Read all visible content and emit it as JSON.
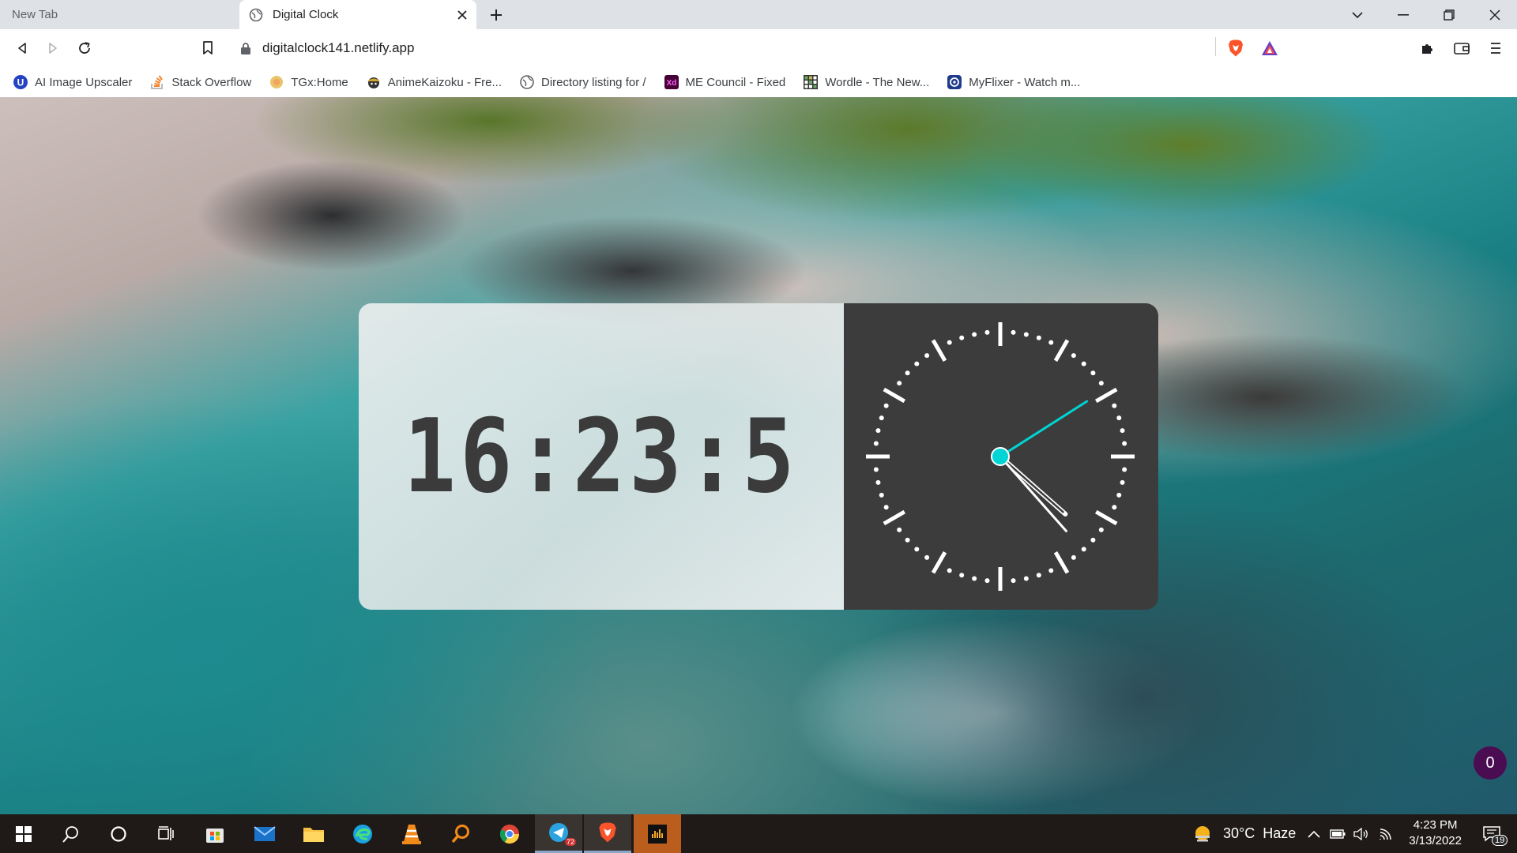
{
  "browser": {
    "tabs": [
      {
        "title": "New Tab",
        "active": false
      },
      {
        "title": "Digital Clock",
        "active": true
      }
    ],
    "url": "digitalclock141.netlify.app",
    "bookmarks": [
      {
        "label": "AI Image Upscaler",
        "icon": "u-circle-icon"
      },
      {
        "label": "Stack Overflow",
        "icon": "stackoverflow-icon"
      },
      {
        "label": "TGx:Home",
        "icon": "tgx-icon"
      },
      {
        "label": "AnimeKaizoku - Fre...",
        "icon": "animekaizoku-icon"
      },
      {
        "label": "Directory listing for /",
        "icon": "globe-icon"
      },
      {
        "label": "ME Council - Fixed",
        "icon": "xd-icon"
      },
      {
        "label": "Wordle - The New...",
        "icon": "wordle-icon"
      },
      {
        "label": "MyFlixer - Watch m...",
        "icon": "myflixer-icon"
      }
    ]
  },
  "clock": {
    "digital": "16:23:5",
    "hours": 16,
    "minutes": 23,
    "seconds": 5,
    "accent_color": "#00d4d4"
  },
  "notification_count": "0",
  "taskbar": {
    "weather": "30°C  Haze",
    "time": "4:23 PM",
    "date": "3/13/2022",
    "notification_badge": "19",
    "telegram_badge": "72"
  }
}
